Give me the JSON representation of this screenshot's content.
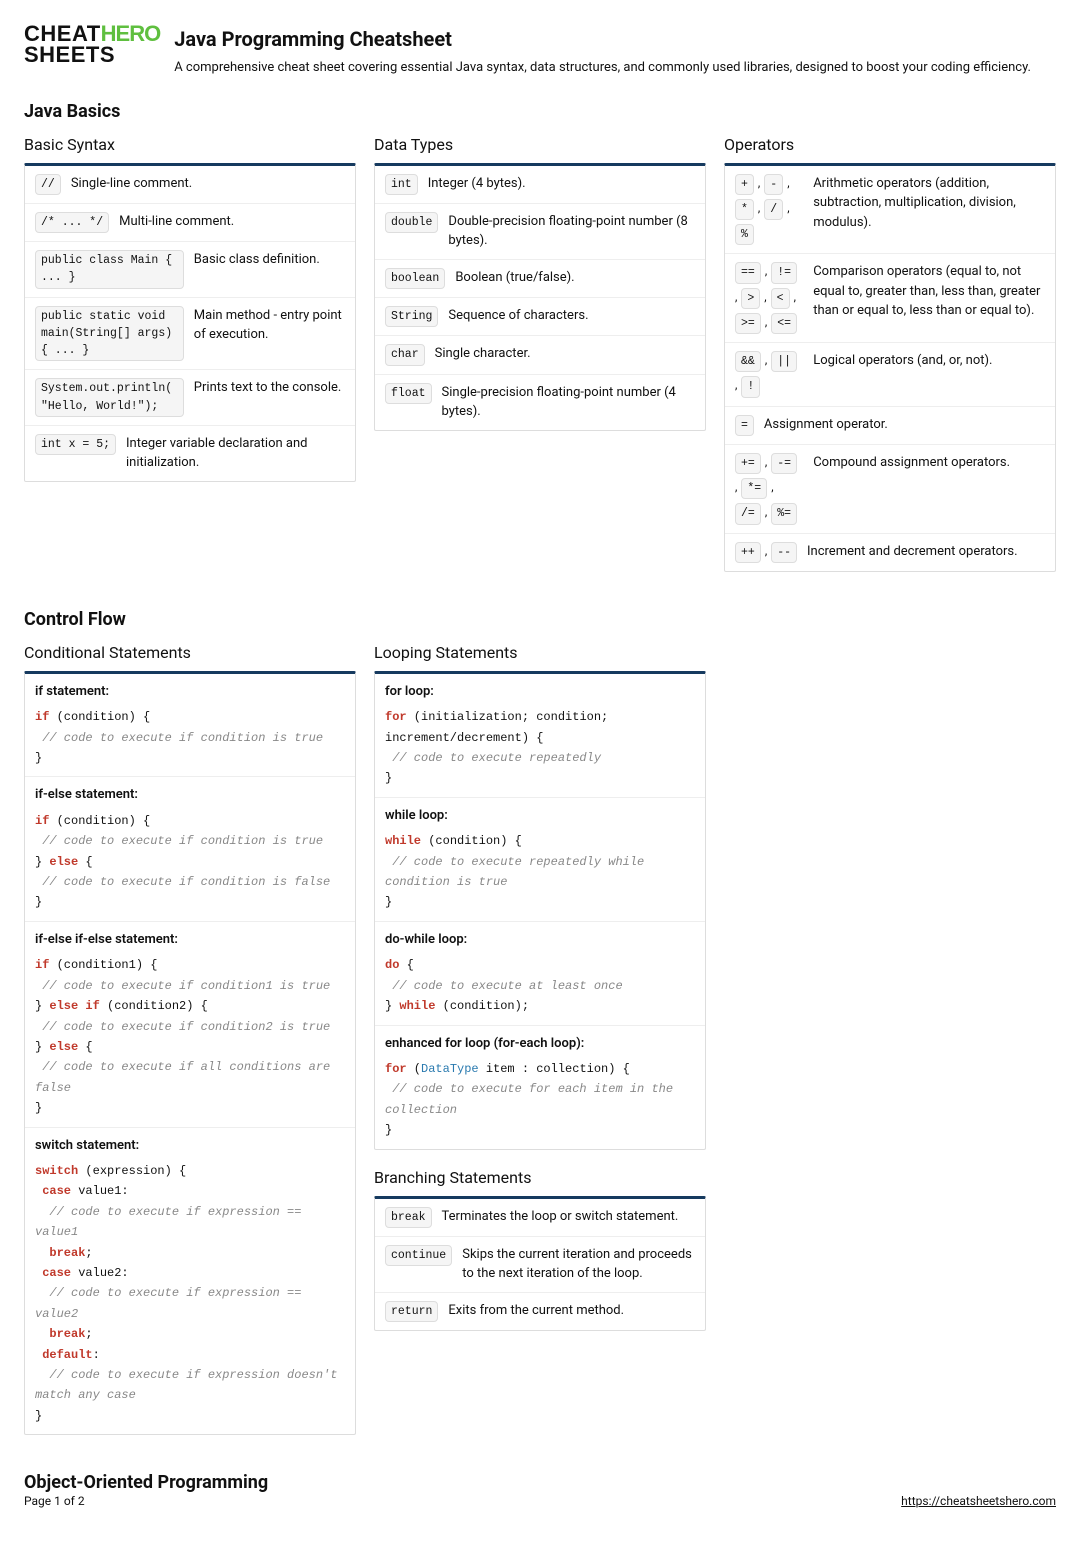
{
  "logo": {
    "line1": "CHEAT",
    "line2": "SHEETS",
    "hero": "HERO"
  },
  "header": {
    "title": "Java Programming Cheatsheet",
    "subtitle": "A comprehensive cheat sheet covering essential Java syntax, data structures, and commonly used libraries, designed to boost your coding efficiency."
  },
  "sections": {
    "basics": {
      "title": "Java Basics",
      "basic_syntax": {
        "title": "Basic Syntax",
        "rows": [
          {
            "codes": [
              "//"
            ],
            "desc": "Single-line comment."
          },
          {
            "codes": [
              "/* ... */"
            ],
            "desc": "Multi-line comment."
          },
          {
            "codes": [
              "public class Main { ... }"
            ],
            "desc": "Basic class definition."
          },
          {
            "codes": [
              "public static void main(String[] args) { ... }"
            ],
            "desc": "Main method - entry point of execution."
          },
          {
            "codes": [
              "System.out.println(\"Hello, World!\");"
            ],
            "desc": "Prints text to the console."
          },
          {
            "codes": [
              "int x = 5;"
            ],
            "desc": "Integer variable declaration and initialization."
          }
        ]
      },
      "data_types": {
        "title": "Data Types",
        "rows": [
          {
            "codes": [
              "int"
            ],
            "desc": "Integer (4 bytes)."
          },
          {
            "codes": [
              "double"
            ],
            "desc": "Double-precision floating-point number (8 bytes)."
          },
          {
            "codes": [
              "boolean"
            ],
            "desc": "Boolean (true/false)."
          },
          {
            "codes": [
              "String"
            ],
            "desc": "Sequence of characters."
          },
          {
            "codes": [
              "char"
            ],
            "desc": "Single character."
          },
          {
            "codes": [
              "float"
            ],
            "desc": "Single-precision floating-point number (4 bytes)."
          }
        ]
      },
      "operators": {
        "title": "Operators",
        "rows": [
          {
            "codes": [
              "+",
              "-",
              "*",
              "/",
              "%"
            ],
            "desc": "Arithmetic operators (addition, subtraction, multiplication, division, modulus)."
          },
          {
            "codes": [
              "==",
              "!=",
              ">",
              "<",
              ">=",
              "<="
            ],
            "desc": "Comparison operators (equal to, not equal to, greater than, less than, greater than or equal to, less than or equal to)."
          },
          {
            "codes": [
              "&&",
              "||",
              "!"
            ],
            "desc": "Logical operators (and, or, not)."
          },
          {
            "codes": [
              "="
            ],
            "desc": "Assignment operator."
          },
          {
            "codes": [
              "+=",
              "-=",
              "*=",
              "/=",
              "%="
            ],
            "desc": "Compound assignment operators."
          },
          {
            "codes": [
              "++",
              "--"
            ],
            "desc": "Increment and decrement operators."
          }
        ]
      }
    },
    "control_flow": {
      "title": "Control Flow",
      "conditional": {
        "title": "Conditional Statements",
        "blocks": [
          {
            "label": "if statement:",
            "code": "<kw>if</kw> (condition) {\n <cm>// code to execute if condition is true</cm>\n}"
          },
          {
            "label": "if-else statement:",
            "code": "<kw>if</kw> (condition) {\n <cm>// code to execute if condition is true</cm>\n} <kw>else</kw> {\n <cm>// code to execute if condition is false</cm>\n}"
          },
          {
            "label": "if-else if-else statement:",
            "code": "<kw>if</kw> (condition1) {\n <cm>// code to execute if condition1 is true</cm>\n} <kw>else if</kw> (condition2) {\n <cm>// code to execute if condition2 is true</cm>\n} <kw>else</kw> {\n <cm>// code to execute if all conditions are false</cm>\n}"
          },
          {
            "label": "switch statement:",
            "code": "<kw>switch</kw> (expression) {\n <kw>case</kw> value1:\n  <cm>// code to execute if expression == value1</cm>\n  <kw>break</kw>;\n <kw>case</kw> value2:\n  <cm>// code to execute if expression == value2</cm>\n  <kw>break</kw>;\n <kw>default</kw>:\n  <cm>// code to execute if expression doesn't match any case</cm>\n}"
          }
        ]
      },
      "looping": {
        "title": "Looping Statements",
        "blocks": [
          {
            "label": "for loop:",
            "code": "<kw>for</kw> (initialization; condition; increment/decrement) {\n <cm>// code to execute repeatedly</cm>\n}"
          },
          {
            "label": "while loop:",
            "code": "<kw>while</kw> (condition) {\n <cm>// code to execute repeatedly while condition is true</cm>\n}"
          },
          {
            "label": "do-while loop:",
            "code": "<kw>do</kw> {\n <cm>// code to execute at least once</cm>\n} <kw>while</kw> (condition);"
          },
          {
            "label": "enhanced for loop (for-each loop):",
            "code": "<kw>for</kw> (<ty>DataType</ty> item : collection) {\n <cm>// code to execute for each item in the collection</cm>\n}"
          }
        ]
      },
      "branching": {
        "title": "Branching Statements",
        "rows": [
          {
            "codes": [
              "break"
            ],
            "desc": "Terminates the loop or switch statement."
          },
          {
            "codes": [
              "continue"
            ],
            "desc": "Skips the current iteration and proceeds to the next iteration of the loop."
          },
          {
            "codes": [
              "return"
            ],
            "desc": "Exits from the current method."
          }
        ]
      }
    },
    "oop": {
      "title": "Object-Oriented Programming"
    }
  },
  "footer": {
    "page": "Page 1 of 2",
    "url": "https://cheatsheetshero.com"
  }
}
